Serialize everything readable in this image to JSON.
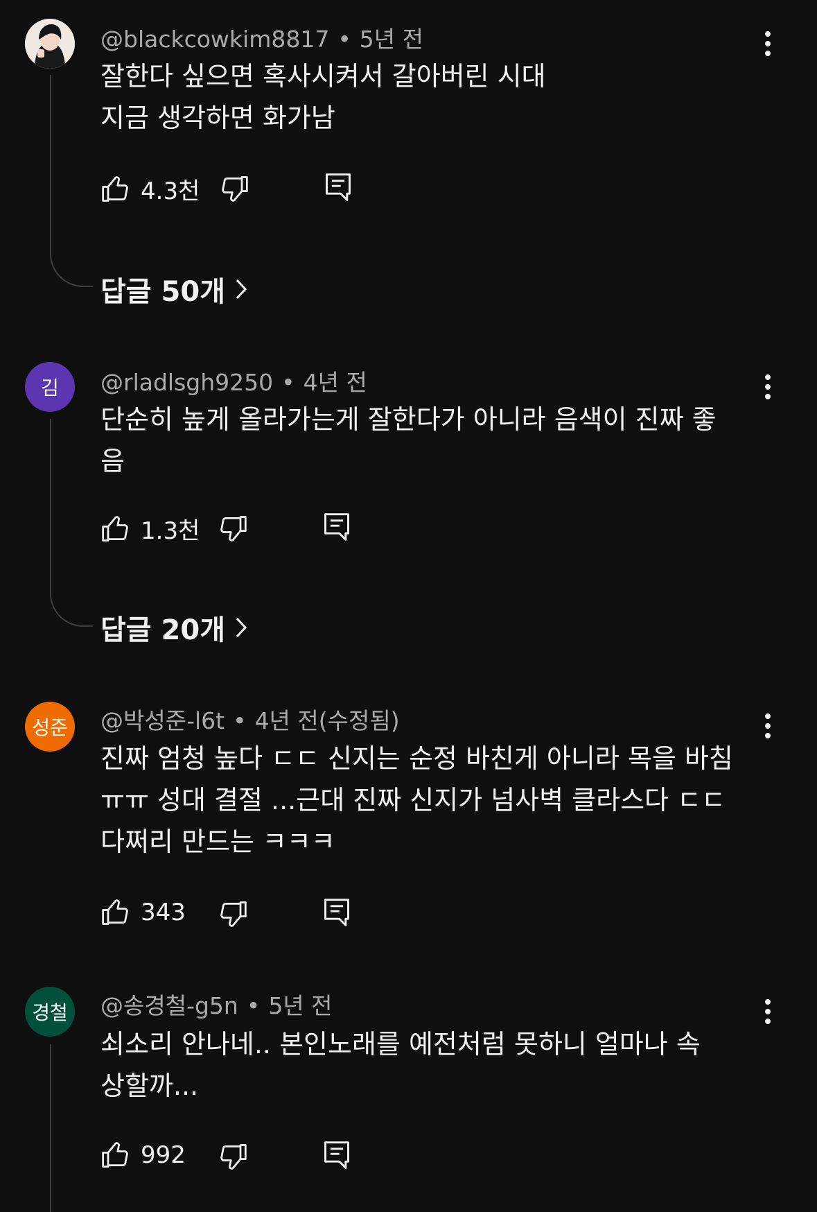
{
  "colors": {
    "background": "#0f0f0f",
    "text": "#f1f1f1",
    "meta": "#aaaaaa",
    "thread_line": "#3f3f3f"
  },
  "comments": [
    {
      "handle": "@blackcowkim8817",
      "time": "5년 전",
      "text": "잘한다 싶으면 혹사시켜서 갈아버린 시대\n지금 생각하면 화가남",
      "likes": "4.3천",
      "replies": "답글 50개",
      "avatar": {
        "type": "photo",
        "color": "#e8e0dc"
      }
    },
    {
      "handle": "@rladlsgh9250",
      "time": "4년 전",
      "text": "단순히 높게 올라가는게 잘한다가 아니라 음색이 진짜 좋\n음",
      "likes": "1.3천",
      "replies": "답글 20개",
      "avatar": {
        "type": "initial",
        "initial": "김",
        "color": "#5c35b0"
      }
    },
    {
      "handle": "@박성준-l6t",
      "time": "4년 전(수정됨)",
      "text": "진짜 엄청 높다 ㄷㄷ 신지는 순정 바친게 아니라 목을 바침\nㅠㅠ 성대 결절 ...근대 진짜 신지가 넘사벽 클라스다 ㄷㄷ\n다쩌리 만드는 ㅋㅋㅋ",
      "likes": "343",
      "avatar": {
        "type": "initial",
        "initial": "성준",
        "color": "#ef6c00"
      }
    },
    {
      "handle": "@송경철-g5n",
      "time": "5년 전",
      "text": "쇠소리 안나네..   본인노래를  예전처럼 못하니 얼마나 속\n상할까...",
      "likes": "992",
      "avatar": {
        "type": "initial",
        "initial": "경철",
        "color": "#00503c"
      }
    }
  ]
}
